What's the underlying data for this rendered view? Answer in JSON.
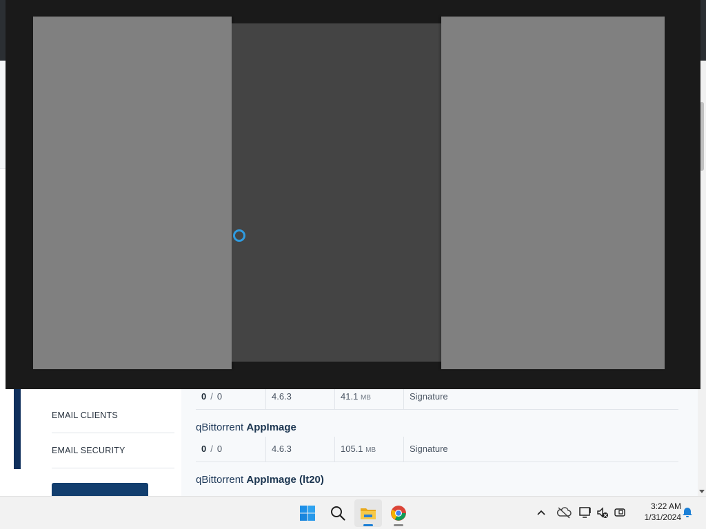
{
  "sidebar": {
    "items": [
      {
        "label": "EMAIL CLIENTS"
      },
      {
        "label": "EMAIL SECURITY"
      }
    ]
  },
  "downloads": [
    {
      "title": null,
      "row": {
        "count": "0",
        "total": "0",
        "separator": "/",
        "version": "4.6.3",
        "size": "41.1",
        "size_unit": "MB",
        "signature": "Signature"
      }
    },
    {
      "title": {
        "prefix": "qBittorrent ",
        "name": "AppImage"
      },
      "row": {
        "count": "0",
        "total": "0",
        "separator": "/",
        "version": "4.6.3",
        "size": "105.1",
        "size_unit": "MB",
        "signature": "Signature"
      }
    },
    {
      "title": {
        "prefix": "qBittorrent ",
        "name": "AppImage (lt20)"
      },
      "row": null
    }
  ],
  "overlay": {
    "panel_colors": {
      "side": "#808080",
      "center": "#444444",
      "frame": "#1a1a1a"
    },
    "cursor": "busy-cursor"
  },
  "taskbar": {
    "apps": [
      {
        "name": "start-button",
        "icon": "windows-logo-icon"
      },
      {
        "name": "search-button",
        "icon": "search-icon"
      },
      {
        "name": "file-explorer-button",
        "icon": "folder-icon",
        "active": true
      },
      {
        "name": "chrome-button",
        "icon": "chrome-icon"
      }
    ],
    "tray": [
      "chevron-up-icon",
      "onedrive-offline-icon",
      "network-icon",
      "speaker-muted-icon",
      "security-icon"
    ],
    "clock": {
      "time": "3:22 AM",
      "date": "1/31/2024"
    },
    "notification_icon": "bell-icon"
  }
}
